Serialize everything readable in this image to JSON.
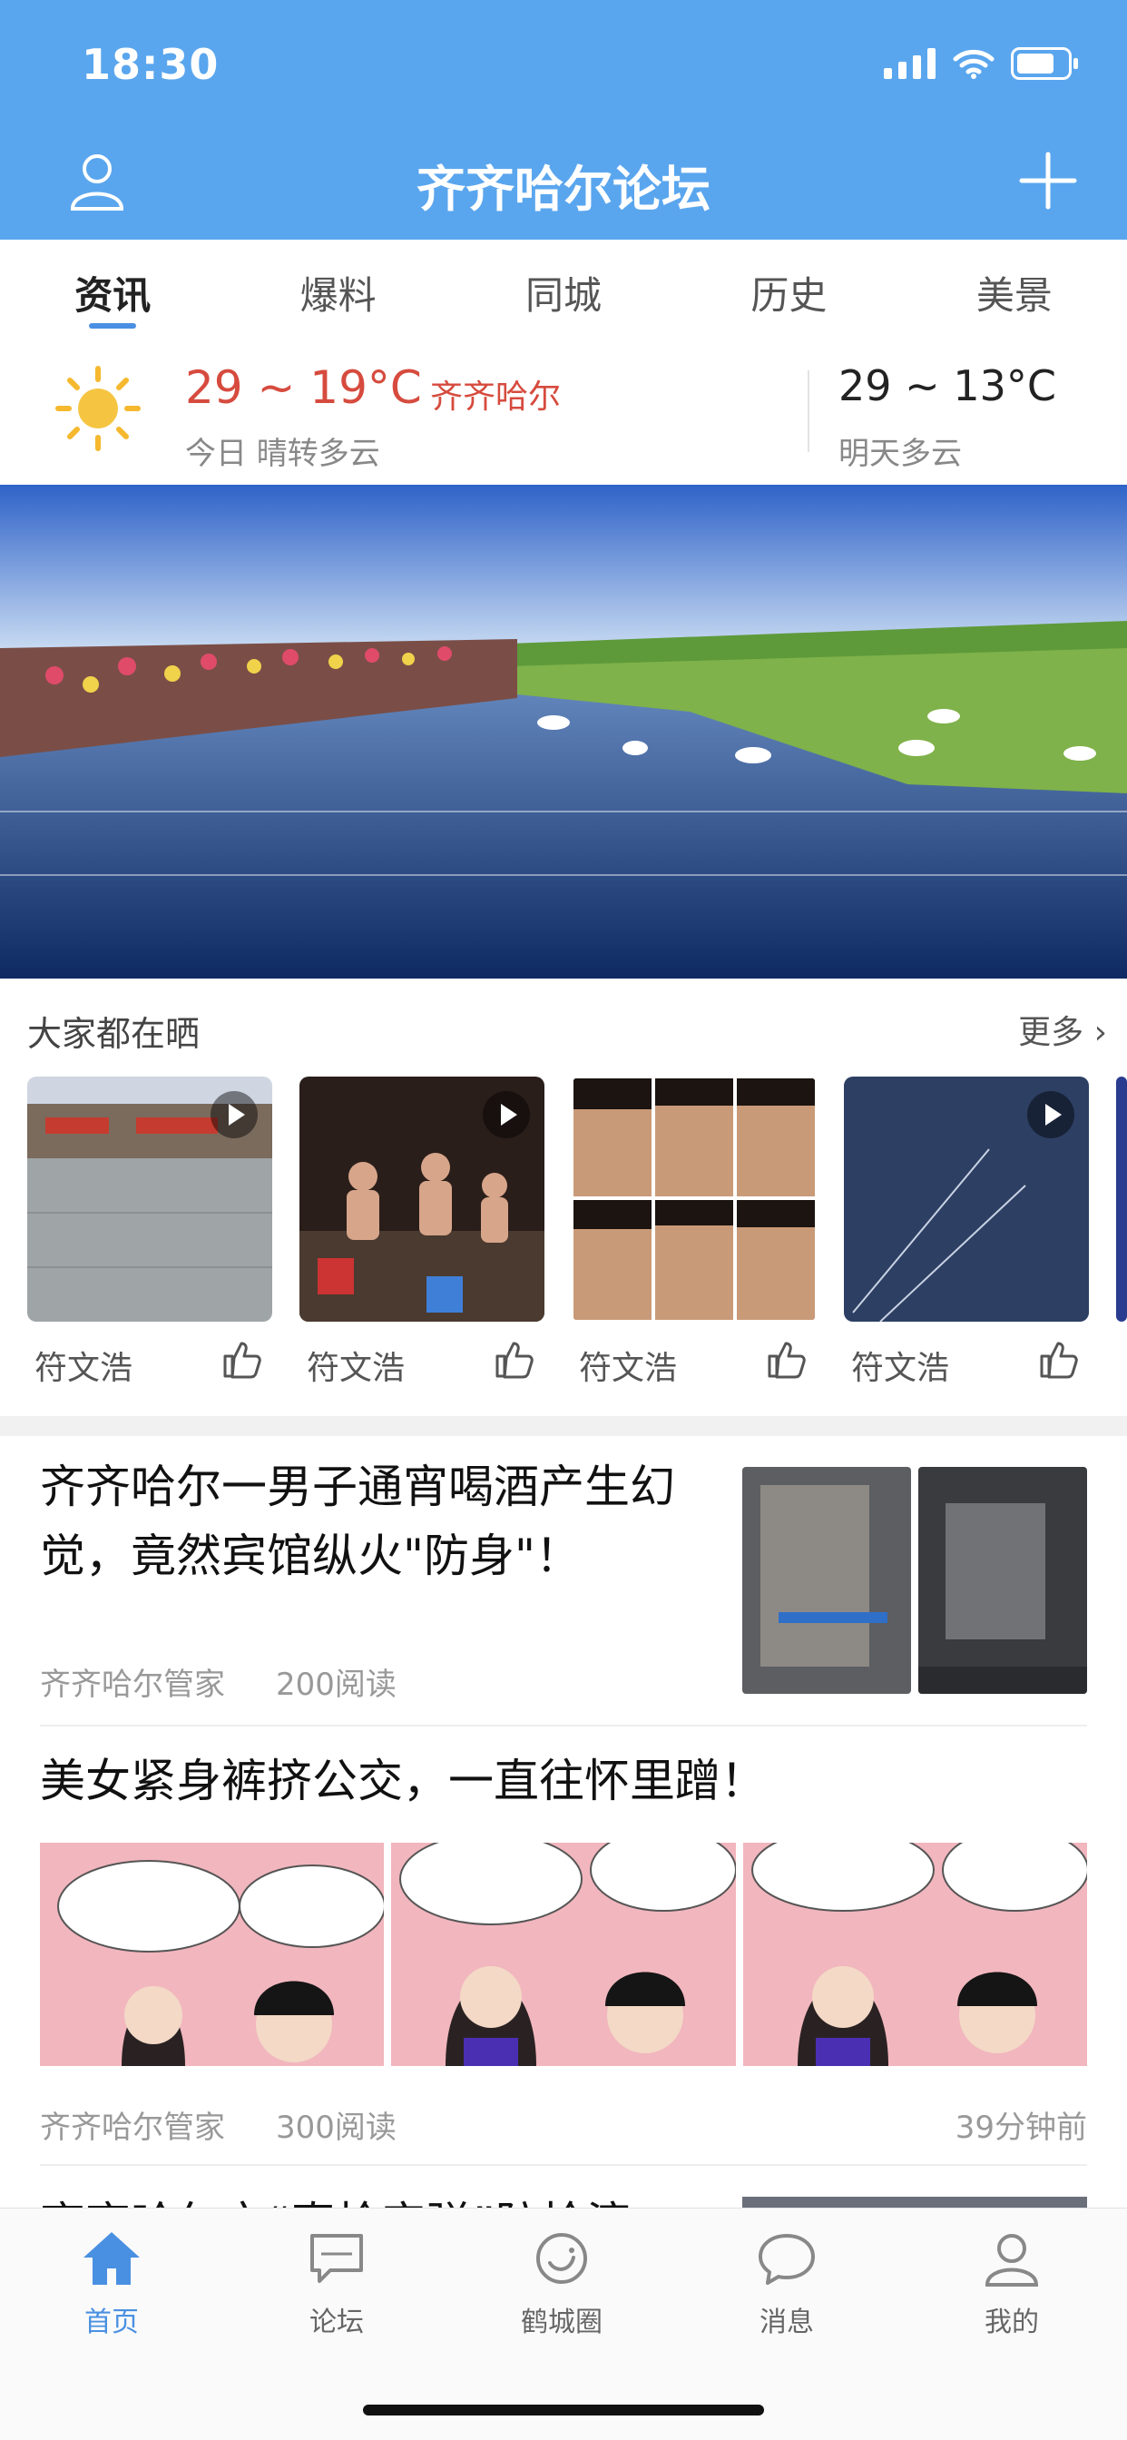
{
  "status": {
    "time": "18:30"
  },
  "header": {
    "title": "齐齐哈尔论坛"
  },
  "tabs": [
    {
      "label": "资讯",
      "active": true
    },
    {
      "label": "爆料",
      "active": false
    },
    {
      "label": "同城",
      "active": false
    },
    {
      "label": "历史",
      "active": false
    },
    {
      "label": "美景",
      "active": false
    }
  ],
  "weather": {
    "today_temp": "29 ~ 19°C",
    "city": "齐齐哈尔",
    "today_desc": "今日 晴转多云",
    "tomorrow_temp": "29 ~ 13°C",
    "tomorrow_desc": "明天多云",
    "icon": "sun-icon"
  },
  "showcase": {
    "title": "大家都在晒",
    "more": "更多 ›",
    "items": [
      {
        "author": "符文浩",
        "video": true
      },
      {
        "author": "符文浩",
        "video": true
      },
      {
        "author": "符文浩",
        "video": false
      },
      {
        "author": "符文浩",
        "video": true
      }
    ]
  },
  "articles": [
    {
      "title": "齐齐哈尔一男子通宵喝酒产生幻觉，竟然宾馆纵火\"防身\"！",
      "source": "齐齐哈尔管家",
      "reads": "200阅读"
    },
    {
      "title": "美女紧身裤挤公交，一直往怀里蹭！",
      "source": "齐齐哈尔管家",
      "reads": "300阅读",
      "time": "39分钟前"
    },
    {
      "title": "齐齐哈尔市“真枪实弹”防抢演"
    }
  ],
  "bottom_nav": [
    {
      "label": "首页",
      "icon": "home-icon",
      "active": true
    },
    {
      "label": "论坛",
      "icon": "forum-icon",
      "active": false
    },
    {
      "label": "鹤城圈",
      "icon": "circle-icon",
      "active": false
    },
    {
      "label": "消息",
      "icon": "message-icon",
      "active": false
    },
    {
      "label": "我的",
      "icon": "profile-icon",
      "active": false
    }
  ],
  "colors": {
    "header_bg": "#5AA6EE",
    "accent": "#4A90E2",
    "temp_red": "#D64B3E"
  }
}
